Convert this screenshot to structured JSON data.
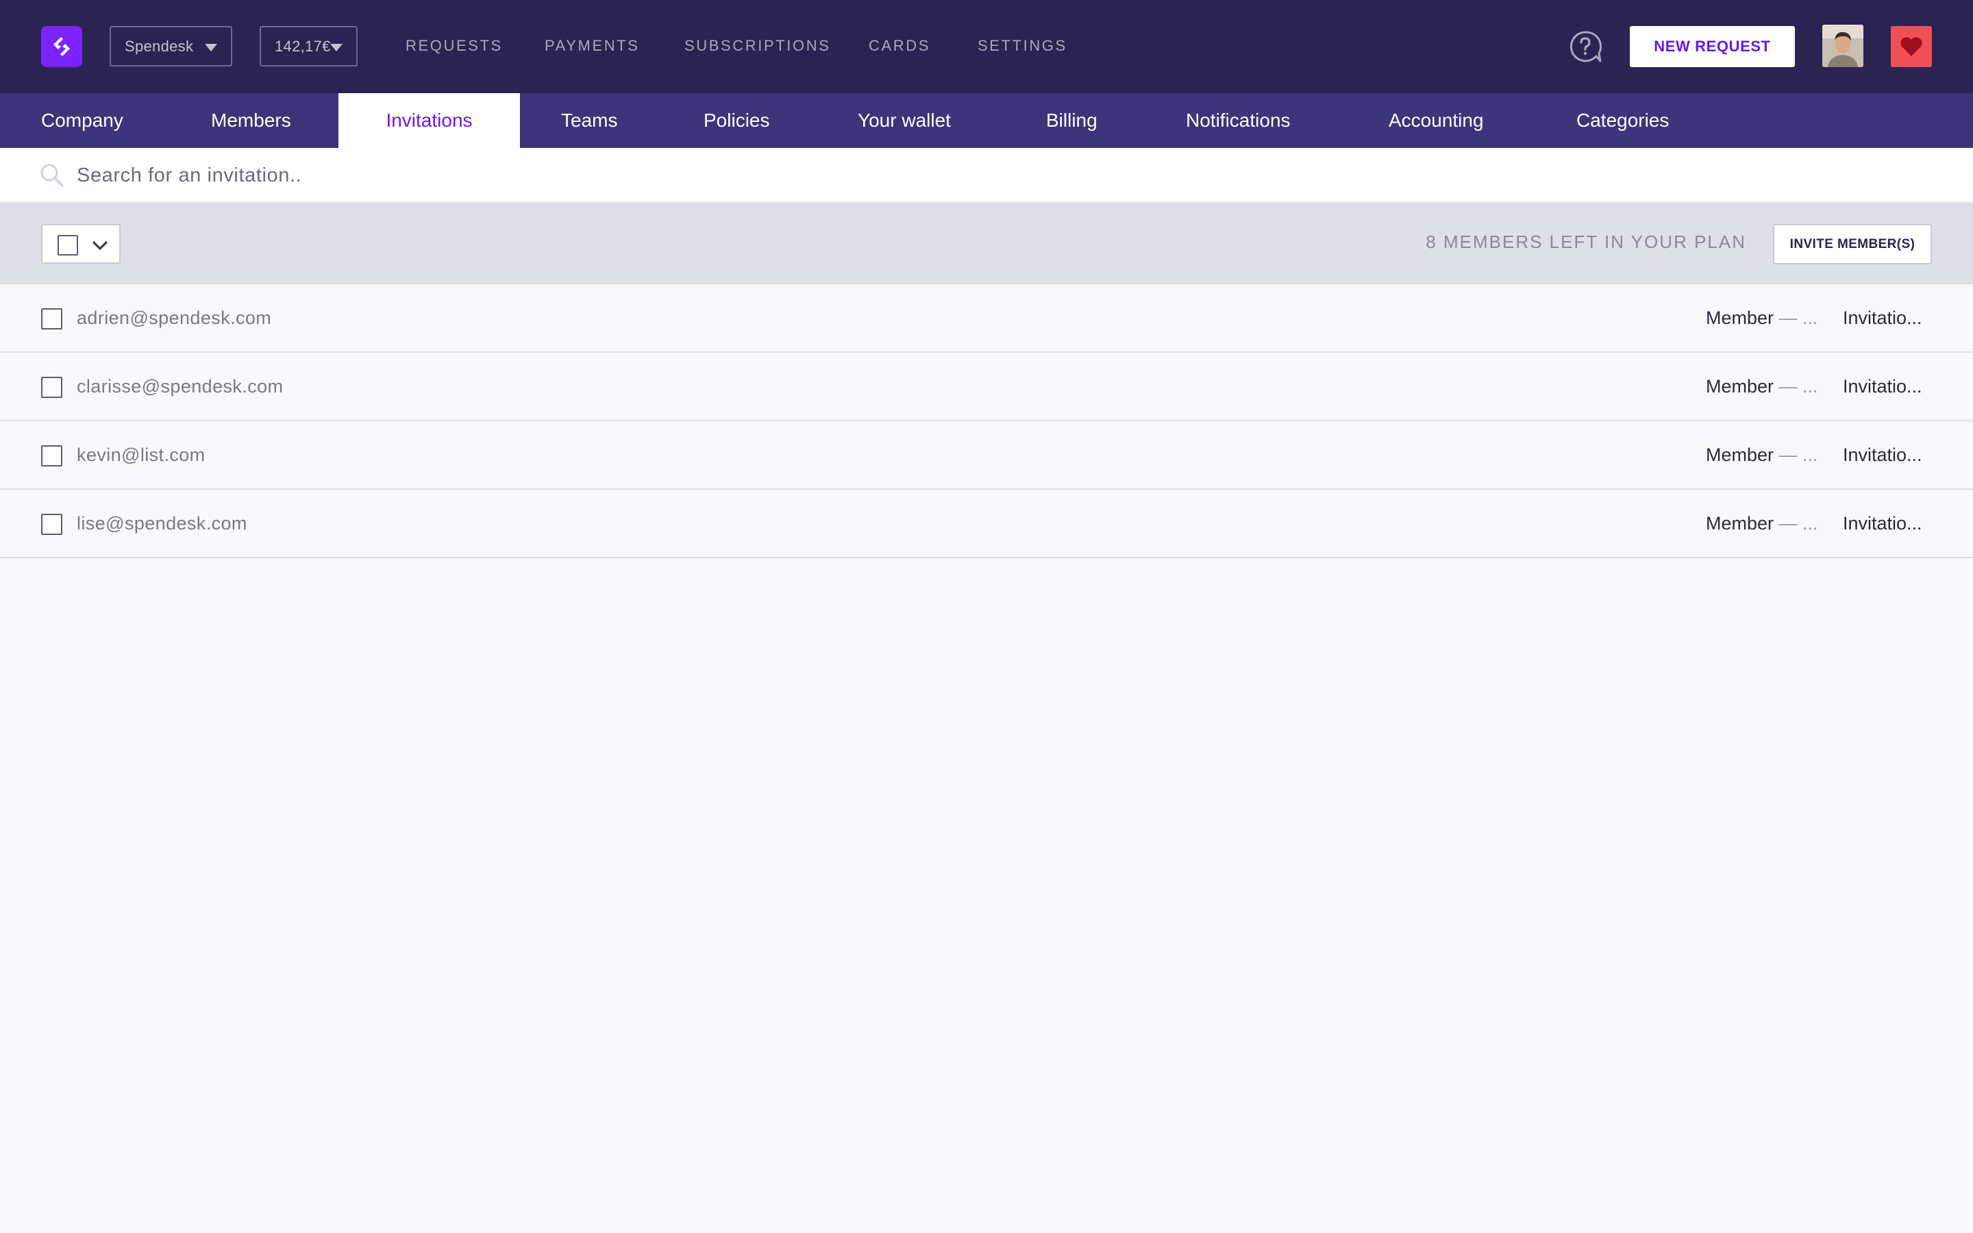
{
  "header": {
    "company_selector": "Spendesk",
    "balance_selector": "142,17€",
    "nav": [
      "REQUESTS",
      "PAYMENTS",
      "SUBSCRIPTIONS",
      "CARDS",
      "SETTINGS"
    ],
    "new_request_label": "NEW REQUEST",
    "icons": [
      "spendesk-logo-icon",
      "help-icon",
      "avatar",
      "heart-icon"
    ],
    "colors": {
      "topbar": "#2b2352",
      "accent": "#7b24ff",
      "heart": "#f14f57"
    }
  },
  "tabs": [
    "Company",
    "Members",
    "Invitations",
    "Teams",
    "Policies",
    "Your wallet",
    "Billing",
    "Notifications",
    "Accounting",
    "Categories"
  ],
  "active_tab": "Invitations",
  "search": {
    "placeholder": "Search for an invitation.."
  },
  "toolbar": {
    "plan_left": "8 MEMBERS LEFT IN YOUR PLAN",
    "invite_label": "INVITE MEMBER(S)"
  },
  "invitations": [
    {
      "email": "adrien@spendesk.com",
      "role": "Member",
      "status": "Invitatio..."
    },
    {
      "email": "clarisse@spendesk.com",
      "role": "Member",
      "status": "Invitatio..."
    },
    {
      "email": "kevin@list.com",
      "role": "Member",
      "status": "Invitatio..."
    },
    {
      "email": "lise@spendesk.com",
      "role": "Member",
      "status": "Invitatio..."
    }
  ],
  "role_suffix": "— ..."
}
